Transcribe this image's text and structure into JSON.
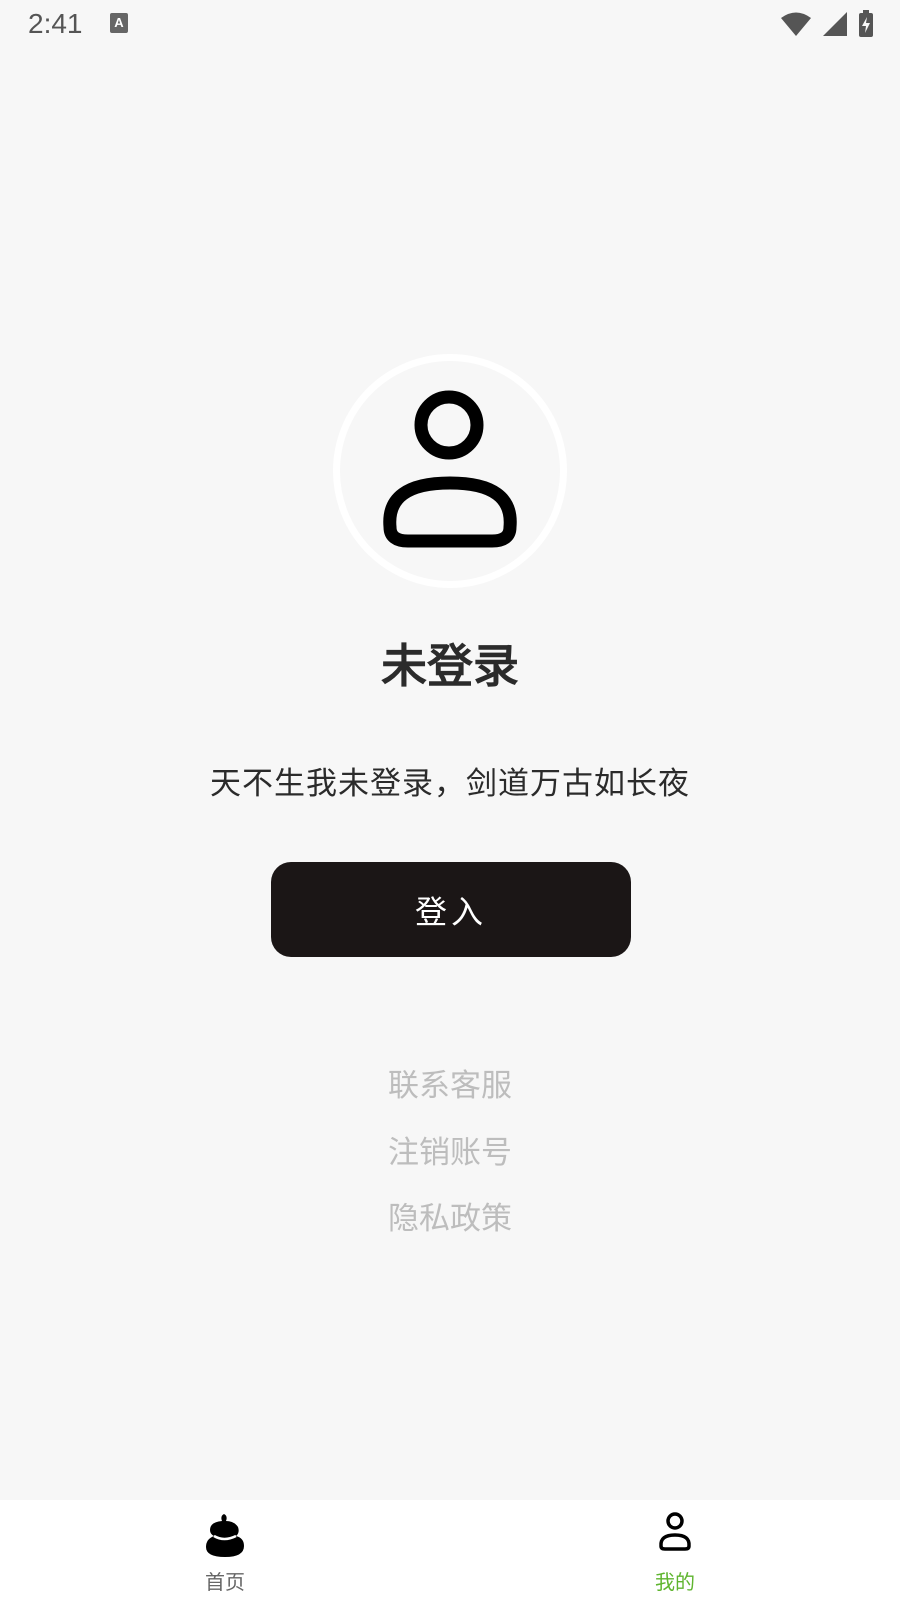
{
  "status_bar": {
    "time": "2:41",
    "notification_glyph": "A"
  },
  "profile": {
    "login_status": "未登录",
    "slogan": "天不生我未登录，剑道万古如长夜",
    "login_button": "登入"
  },
  "menu": [
    {
      "label": "联系客服"
    },
    {
      "label": "注销账号"
    },
    {
      "label": "隐私政策"
    }
  ],
  "tabs": [
    {
      "label": "首页",
      "icon": "home-blob-icon",
      "active": false
    },
    {
      "label": "我的",
      "icon": "person-icon",
      "active": true
    }
  ],
  "colors": {
    "background": "#f7f7f7",
    "button": "#1b1616",
    "active_tab": "#5fb52f",
    "inactive_tab": "#666666",
    "muted_link": "#bdbdbd"
  }
}
